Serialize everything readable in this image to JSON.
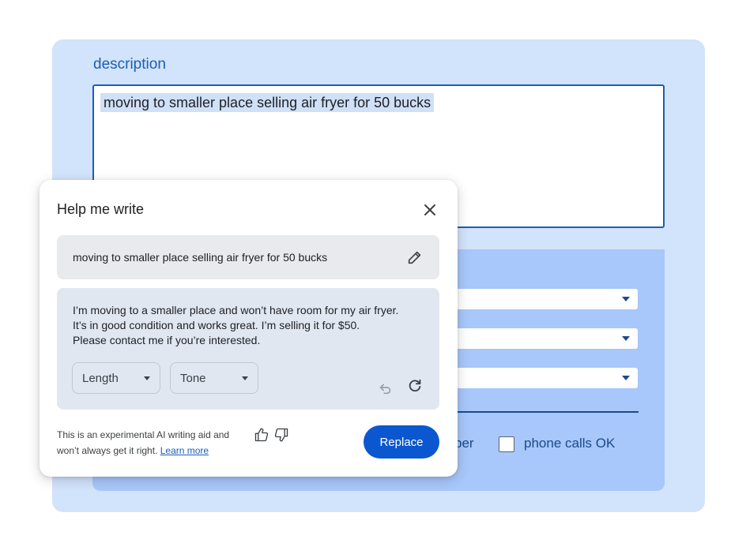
{
  "form": {
    "description_label": "description",
    "description_value": "moving to smaller place selling air fryer for 50 bucks",
    "partial_label": "ber",
    "checkbox_label": "phone calls OK"
  },
  "dialog": {
    "title": "Help me write",
    "prompt": "moving to smaller place selling air fryer for 50 bucks",
    "result_lines": [
      "I’m moving to a smaller place and won’t have room for my air fryer.",
      "It’s in good condition and works great. I’m selling it for $50.",
      "Please contact me if you’re interested."
    ],
    "length_label": "Length",
    "tone_label": "Tone",
    "disclaimer_line1": "This is an experimental AI writing aid and",
    "disclaimer_line2": "won’t always get it right.",
    "learn_more": "Learn more",
    "replace_label": "Replace"
  },
  "icons": {
    "close": "close-icon",
    "edit": "pencil-icon",
    "undo": "undo-icon",
    "redo": "refresh-icon",
    "thumbs_up": "thumbs-up-icon",
    "thumbs_down": "thumbs-down-icon"
  },
  "colors": {
    "panel": "#d2e3fc",
    "inner_panel": "#a8c7fa",
    "accent": "#0b57d0",
    "label_blue": "#1a5fb4"
  }
}
